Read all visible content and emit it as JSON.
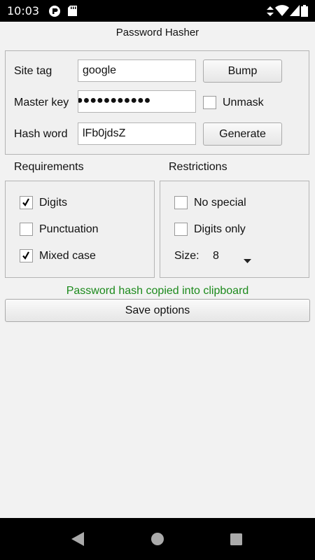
{
  "status_bar": {
    "time": "10:03"
  },
  "app": {
    "title": "Password Hasher"
  },
  "form": {
    "site_tag": {
      "label": "Site tag",
      "value": "google"
    },
    "master_key": {
      "label": "Master key",
      "masked_value": "●●●●●●●●●●●"
    },
    "hash_word": {
      "label": "Hash word",
      "value": "lFb0jdsZ"
    },
    "bump_label": "Bump",
    "generate_label": "Generate",
    "unmask": {
      "label": "Unmask",
      "checked": false
    }
  },
  "requirements": {
    "title": "Requirements",
    "digits": {
      "label": "Digits",
      "checked": true
    },
    "punctuation": {
      "label": "Punctuation",
      "checked": false
    },
    "mixed_case": {
      "label": "Mixed case",
      "checked": true
    }
  },
  "restrictions": {
    "title": "Restrictions",
    "no_special": {
      "label": "No special",
      "checked": false
    },
    "digits_only": {
      "label": "Digits only",
      "checked": false
    },
    "size": {
      "label": "Size:",
      "value": "8"
    }
  },
  "status_message": "Password hash copied into clipboard",
  "save_options_label": "Save options",
  "colors": {
    "status_message": "#1c8a1c",
    "background": "#f2f2f2"
  }
}
